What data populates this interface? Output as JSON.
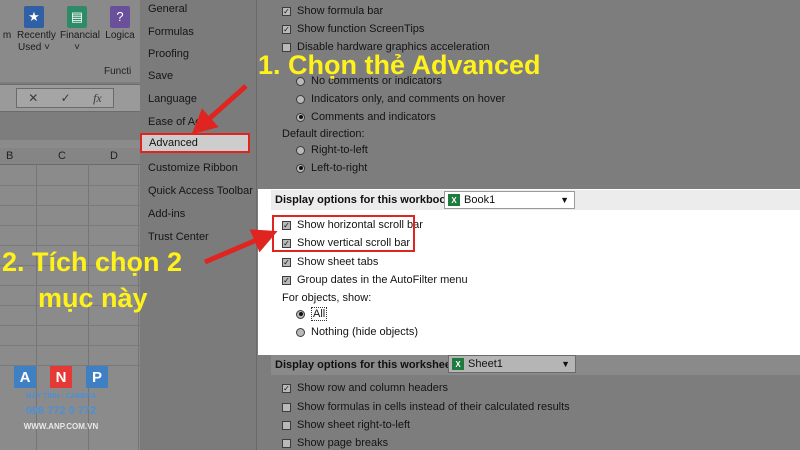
{
  "ribbon": {
    "buttons": [
      {
        "label": "m",
        "icon": "none"
      },
      {
        "label": "Recently Used ˅",
        "icon": "star-icon"
      },
      {
        "label": "Financial ˅",
        "icon": "book-icon"
      },
      {
        "label": "Logica",
        "icon": "question-icon"
      }
    ],
    "group_label": "Functi",
    "formula_symbols": [
      "✕",
      "✓",
      "fx"
    ],
    "columns": [
      "B",
      "C",
      "D"
    ]
  },
  "nav": {
    "items": [
      "General",
      "Formulas",
      "Proofing",
      "Save",
      "Language",
      "Ease of Acc",
      "Advanced",
      "Customize Ribbon",
      "Quick Access Toolbar",
      "Add-ins",
      "Trust Center"
    ],
    "selected": "Advanced"
  },
  "display_top": {
    "show_formula_bar": "Show formula bar",
    "show_screentips": "Show function ScreenTips",
    "disable_hw": "Disable hardware graphics acceleration",
    "no_comments": "No comments or indicators",
    "indicators_only": "Indicators only, and comments on hover",
    "comments_indicators": "Comments and indicators",
    "default_direction": "Default direction:",
    "rtl": "Right-to-left",
    "ltr": "Left-to-right"
  },
  "workbook": {
    "header": "Display options for this workbook:",
    "book": "Book1",
    "horizontal": "Show horizontal scroll bar",
    "vertical": "Show vertical scroll bar",
    "sheet_tabs": "Show sheet tabs",
    "group_dates": "Group dates in the AutoFilter menu",
    "for_objects": "For objects, show:",
    "all": "All",
    "nothing": "Nothing (hide objects)"
  },
  "worksheet": {
    "header": "Display options for this worksheet:",
    "sheet": "Sheet1",
    "row_col_headers": "Show row and column headers",
    "formulas_cells": "Show formulas in cells instead of their calculated results",
    "sheet_rtl": "Show sheet right-to-left",
    "page_breaks": "Show page breaks"
  },
  "annotations": {
    "step1": "1. Chọn thẻ Advanced",
    "step2_line1": "2. Tích chọn 2",
    "step2_line2": "mục này"
  },
  "logo": {
    "letters": [
      "A",
      "N",
      "P"
    ],
    "tagline": "MÁY TÍNH - CAMERA",
    "phone": "098 772 0 772",
    "site": "WWW.ANP.COM.VN"
  },
  "colors": {
    "highlight_red": "#e0241f",
    "annotation_yellow": "#fff21a",
    "logo_blue": "#3f7fc4",
    "logo_red": "#e53935"
  }
}
